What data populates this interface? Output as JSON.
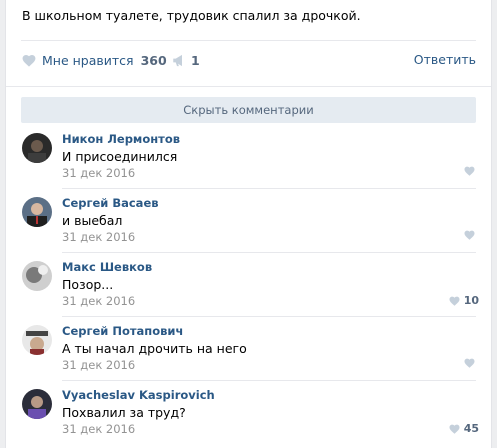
{
  "post": {
    "text": "В школьном туалете, трудовик спалил за дрочкой.",
    "like_label": "Мне нравится",
    "like_count": "360",
    "share_count": "1",
    "reply_label": "Ответить"
  },
  "hide_comments_label": "Скрыть комментарии",
  "comments": [
    {
      "author": "Никон Лермонтов",
      "text": "И присоединился",
      "date": "31 дек 2016",
      "likes": ""
    },
    {
      "author": "Сергей Васаев",
      "text": "и выебал",
      "date": "31 дек 2016",
      "likes": ""
    },
    {
      "author": "Макс Шевков",
      "text": "Позор...",
      "date": "31 дек 2016",
      "likes": "10"
    },
    {
      "author": "Сергей Потапович",
      "text": "А ты начал дрочить на него",
      "date": "31 дек 2016",
      "likes": ""
    },
    {
      "author": "Vyacheslav Kaspirovich",
      "text": "Похвалил за труд?",
      "date": "31 дек 2016",
      "likes": "45"
    }
  ],
  "colors": {
    "link": "#2a5885",
    "muted": "#939393",
    "bar_bg": "#e5ebf1",
    "heart": "#c5d0db"
  },
  "icons": {
    "like": "heart-icon",
    "share": "megaphone-icon"
  }
}
